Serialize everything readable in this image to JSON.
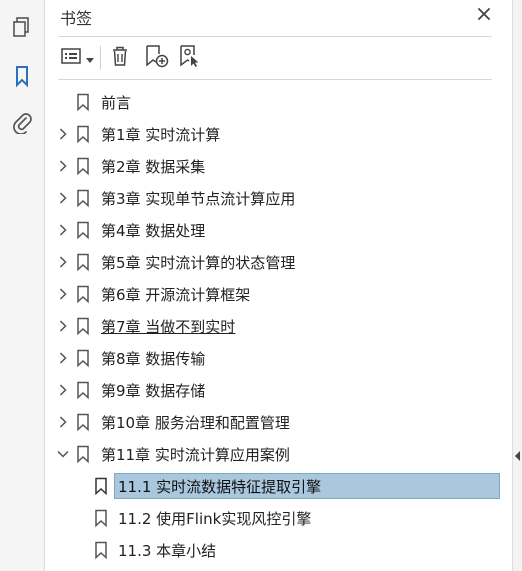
{
  "panel": {
    "title": "书签"
  },
  "rail": {
    "items": [
      {
        "icon": "pages-icon"
      },
      {
        "icon": "bookmark-icon",
        "active": true
      },
      {
        "icon": "attachment-icon"
      }
    ]
  },
  "toolbar": {
    "buttons": [
      "options-menu-icon",
      "delete-icon",
      "new-bookmark-icon",
      "bookmark-from-selection-icon"
    ]
  },
  "tree": {
    "items": [
      {
        "label": "前言",
        "expander": "none"
      },
      {
        "label": "第1章 实时流计算",
        "expander": "collapsed"
      },
      {
        "label": "第2章 数据采集",
        "expander": "collapsed"
      },
      {
        "label": "第3章 实现单节点流计算应用",
        "expander": "collapsed"
      },
      {
        "label": "第4章 数据处理",
        "expander": "collapsed"
      },
      {
        "label": "第5章 实时流计算的状态管理",
        "expander": "collapsed"
      },
      {
        "label": "第6章 开源流计算框架",
        "expander": "collapsed"
      },
      {
        "label": "第7章 当做不到实时",
        "expander": "collapsed",
        "underlined": true
      },
      {
        "label": "第8章 数据传输",
        "expander": "collapsed"
      },
      {
        "label": "第9章 数据存储",
        "expander": "collapsed"
      },
      {
        "label": "第10章 服务治理和配置管理",
        "expander": "collapsed"
      },
      {
        "label": "第11章 实时流计算应用案例",
        "expander": "expanded"
      }
    ],
    "children": [
      {
        "label": "11.1 实时流数据特征提取引擎",
        "selected": true
      },
      {
        "label": "11.2 使用Flink实现风控引擎"
      },
      {
        "label": "11.3 本章小结"
      }
    ]
  },
  "colors": {
    "accent": "#2d6fb8",
    "selection": "#a9c8de",
    "icon": "#555555"
  }
}
